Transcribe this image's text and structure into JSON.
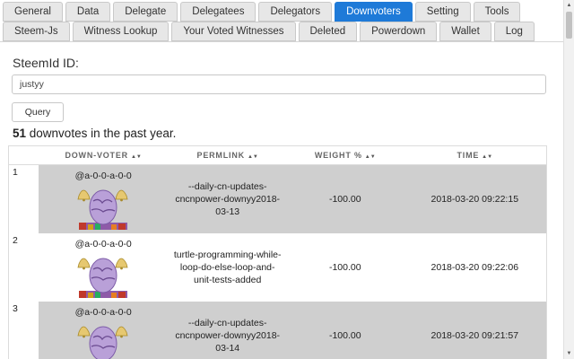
{
  "tabs_row1": [
    {
      "label": "General",
      "name": "tab-general",
      "active": false
    },
    {
      "label": "Data",
      "name": "tab-data",
      "active": false
    },
    {
      "label": "Delegate",
      "name": "tab-delegate",
      "active": false
    },
    {
      "label": "Delegatees",
      "name": "tab-delegatees",
      "active": false
    },
    {
      "label": "Delegators",
      "name": "tab-delegators",
      "active": false
    },
    {
      "label": "Downvoters",
      "name": "tab-downvoters",
      "active": true
    },
    {
      "label": "Setting",
      "name": "tab-setting",
      "active": false
    },
    {
      "label": "Tools",
      "name": "tab-tools",
      "active": false
    }
  ],
  "tabs_row2": [
    {
      "label": "Steem-Js",
      "name": "tab-steem-js",
      "active": false
    },
    {
      "label": "Witness Lookup",
      "name": "tab-witness-lookup",
      "active": false
    },
    {
      "label": "Your Voted Witnesses",
      "name": "tab-your-voted-witnesses",
      "active": false
    },
    {
      "label": "Deleted",
      "name": "tab-deleted",
      "active": false
    },
    {
      "label": "Powerdown",
      "name": "tab-powerdown",
      "active": false
    },
    {
      "label": "Wallet",
      "name": "tab-wallet",
      "active": false
    },
    {
      "label": "Log",
      "name": "tab-log",
      "active": false
    }
  ],
  "form": {
    "label": "SteemId ID:",
    "input_value": "justyy",
    "query_label": "Query"
  },
  "summary": {
    "count": "51",
    "text": " downvotes in the past year."
  },
  "table": {
    "headers": [
      "",
      "DOWN-VOTER",
      "PERMLINK",
      "WEIGHT %",
      "TIME"
    ],
    "sort_glyph": "▲▼",
    "rows": [
      {
        "index": "1",
        "voter": "@a-0-0-a-0-0",
        "permlink": "--daily-cn-updates-cncnpower-downyy2018-03-13",
        "weight": "-100.00",
        "time": "2018-03-20 09:22:15"
      },
      {
        "index": "2",
        "voter": "@a-0-0-a-0-0",
        "permlink": "turtle-programming-while-loop-do-else-loop-and-unit-tests-added",
        "weight": "-100.00",
        "time": "2018-03-20 09:22:06"
      },
      {
        "index": "3",
        "voter": "@a-0-0-a-0-0",
        "permlink": "--daily-cn-updates-cncnpower-downyy2018-03-14",
        "weight": "-100.00",
        "time": "2018-03-20 09:21:57"
      }
    ]
  },
  "avatar_icon": "egg-with-bells-icon",
  "colors": {
    "active_tab": "#1e7ad8",
    "odd_row": "#cfcfcf"
  }
}
